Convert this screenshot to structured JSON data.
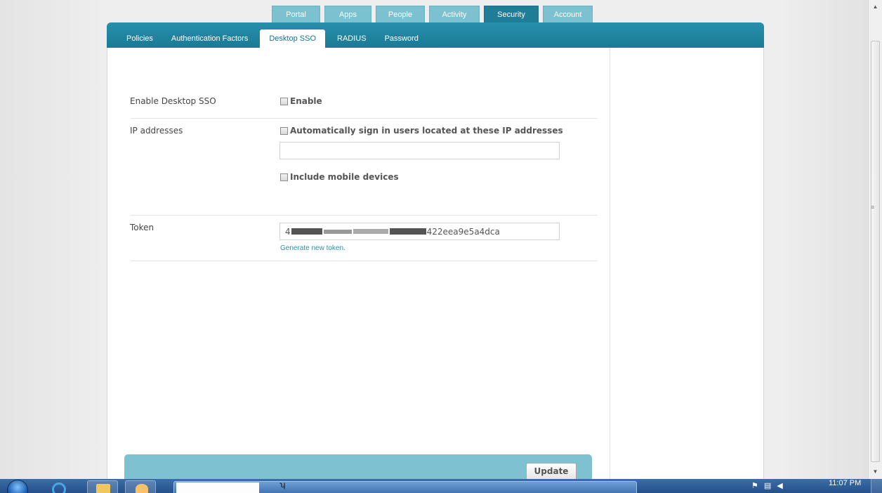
{
  "top_tabs": [
    {
      "label": "Portal"
    },
    {
      "label": "Apps"
    },
    {
      "label": "People"
    },
    {
      "label": "Activity"
    },
    {
      "label": "Security"
    },
    {
      "label": "Account"
    }
  ],
  "sub_tabs": [
    {
      "label": "Policies"
    },
    {
      "label": "Authentication Factors"
    },
    {
      "label": "Desktop SSO"
    },
    {
      "label": "RADIUS"
    },
    {
      "label": "Password"
    }
  ],
  "form": {
    "enable_label": "Enable Desktop SSO",
    "enable_checkbox_label": "Enable",
    "ip_label": "IP addresses",
    "auto_signin_label": "Automatically sign in users located at these IP addresses",
    "ip_input_value": "",
    "mobile_label": "Include mobile devices",
    "token_label": "Token",
    "token_prefix": "4",
    "token_suffix": "422eea9e5a4dca",
    "generate_link": "Generate new token."
  },
  "footer": {
    "update_label": "Update"
  },
  "taskbar": {
    "clock": "11:07 PM"
  },
  "colors": {
    "header": "#1a7a95",
    "tab_inactive": "#7bc1cf",
    "tab_active": "#1f7d97",
    "footer_bar": "#7ec1d0",
    "link": "#2c8fad"
  },
  "icons": [
    "start-orb-icon",
    "internet-explorer-icon",
    "folder-icon",
    "outlook-icon",
    "scroll-up-icon",
    "scroll-down-icon"
  ]
}
